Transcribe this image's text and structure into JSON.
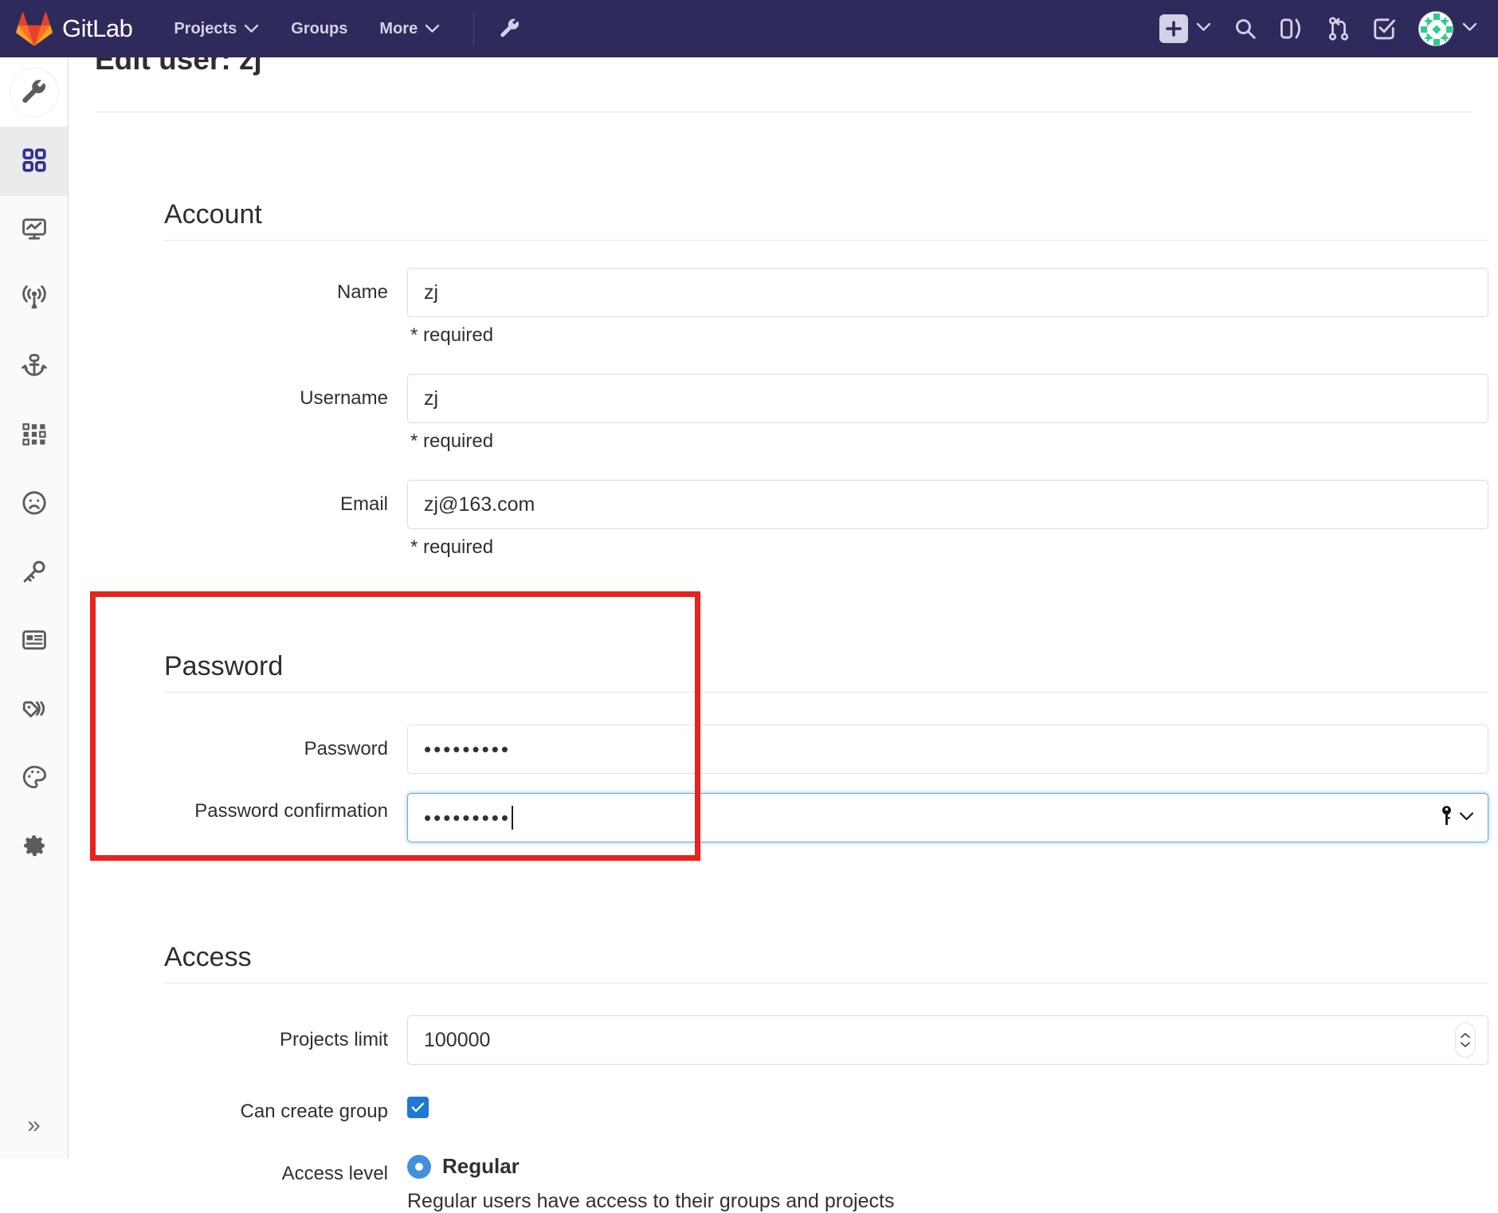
{
  "navbar": {
    "brand": "GitLab",
    "items": [
      {
        "label": "Projects",
        "has_chevron": true
      },
      {
        "label": "Groups",
        "has_chevron": false
      },
      {
        "label": "More",
        "has_chevron": true
      }
    ],
    "admin_icon": "wrench-icon",
    "right_icons": [
      "plus-icon",
      "chevron-down-icon",
      "search-icon",
      "issues-icon",
      "merge-requests-icon",
      "todos-icon"
    ],
    "avatar_alt": "user-avatar",
    "accent_bg": "#2e2a5b",
    "text_color": "#d3d1e8"
  },
  "sidebar": {
    "items": [
      {
        "name": "admin-area",
        "icon": "wrench-icon",
        "active": false
      },
      {
        "name": "overview",
        "icon": "grid-squares-icon",
        "active": true
      },
      {
        "name": "monitoring",
        "icon": "monitor-chart-icon",
        "active": false
      },
      {
        "name": "system-hooks",
        "icon": "broadcast-icon",
        "active": false
      },
      {
        "name": "kubernetes",
        "icon": "anchor-icon",
        "active": false
      },
      {
        "name": "applications",
        "icon": "dots-grid-icon",
        "active": false
      },
      {
        "name": "abuse-reports",
        "icon": "sad-face-icon",
        "active": false
      },
      {
        "name": "deploy-keys",
        "icon": "key-icon",
        "active": false
      },
      {
        "name": "license",
        "icon": "news-card-icon",
        "active": false
      },
      {
        "name": "labels",
        "icon": "labels-icon",
        "active": false
      },
      {
        "name": "appearance",
        "icon": "palette-icon",
        "active": false
      },
      {
        "name": "settings",
        "icon": "gear-icon",
        "active": false
      }
    ],
    "collapse_toggle": "»"
  },
  "page": {
    "title": "Edit user: zj"
  },
  "account": {
    "section_title": "Account",
    "fields": [
      {
        "label": "Name",
        "value": "zj",
        "note": "* required"
      },
      {
        "label": "Username",
        "value": "zj",
        "note": "* required"
      },
      {
        "label": "Email",
        "value": "zj@163.com",
        "note": "* required"
      }
    ]
  },
  "password": {
    "section_title": "Password",
    "fields": [
      {
        "label": "Password",
        "value": "•••••••••",
        "focused": false
      },
      {
        "label": "Password confirmation",
        "value": "•••••••••",
        "focused": true
      }
    ],
    "password_manager_icon": "key-icon",
    "password_manager_chevron": "chevron-down-icon",
    "highlight_color": "#e8221c"
  },
  "access": {
    "section_title": "Access",
    "projects_limit_label": "Projects limit",
    "projects_limit_value": "100000",
    "can_create_group_label": "Can create group",
    "can_create_group_checked": true,
    "access_level_label": "Access level",
    "access_level_options": [
      {
        "label": "Regular",
        "selected": true
      }
    ],
    "access_level_description": "Regular users have access to their groups and projects"
  }
}
